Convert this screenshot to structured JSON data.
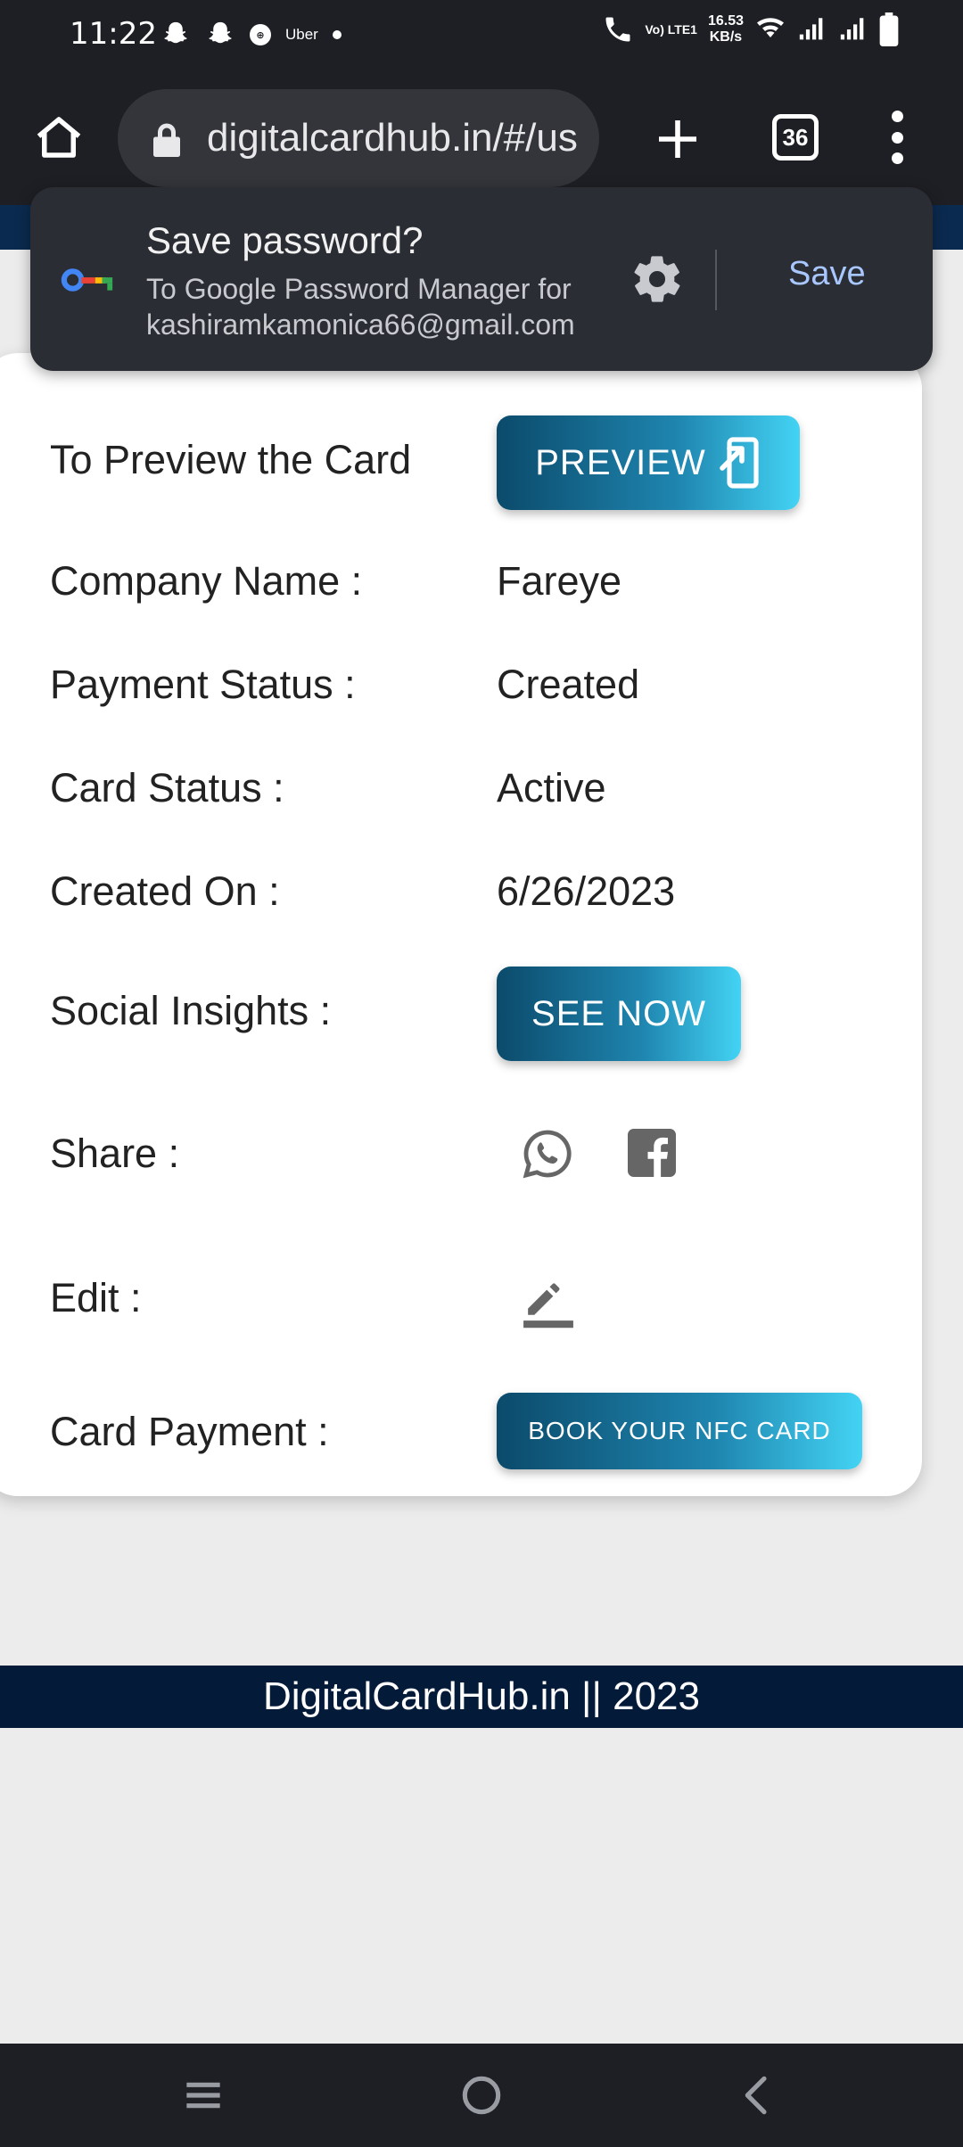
{
  "status_bar": {
    "time": "11:22",
    "uber_label": "Uber",
    "lte_label": "Vo) LTE1",
    "net_speed_value": "16.53",
    "net_speed_unit": "KB/s"
  },
  "browser": {
    "url": "digitalcardhub.in/#/us",
    "tab_count": "36"
  },
  "password_prompt": {
    "title": "Save password?",
    "subtitle_line1": "To Google Password Manager for",
    "subtitle_line2": "kashiramkamonica66@gmail.com",
    "save_label": "Save"
  },
  "card": {
    "preview_label": "To Preview the Card",
    "preview_button": "PREVIEW",
    "company_label": "Company Name :",
    "company_value": "Fareye",
    "payment_status_label": "Payment Status :",
    "payment_status_value": "Created",
    "card_status_label": "Card Status :",
    "card_status_value": "Active",
    "created_on_label": "Created On :",
    "created_on_value": "6/26/2023",
    "social_insights_label": "Social Insights :",
    "see_now_button": "SEE NOW",
    "share_label": "Share :",
    "edit_label": "Edit :",
    "card_payment_label": "Card Payment :",
    "book_nfc_button": "BOOK YOUR NFC CARD"
  },
  "footer": {
    "text": "DigitalCardHub.in || 2023"
  },
  "icons": {
    "home": "home-icon",
    "lock": "lock-icon",
    "plus": "plus-icon",
    "menu": "more-vert-icon",
    "key": "key-icon",
    "gear": "gear-icon",
    "whatsapp": "whatsapp-icon",
    "facebook": "facebook-icon",
    "edit": "edit-pencil-icon"
  },
  "colors": {
    "browser_bg": "#1e1f24",
    "footer_bg": "#031a38",
    "button_gradient_start": "#0b4a6b",
    "button_gradient_end": "#43d3f4",
    "save_link": "#a9c7ff"
  }
}
